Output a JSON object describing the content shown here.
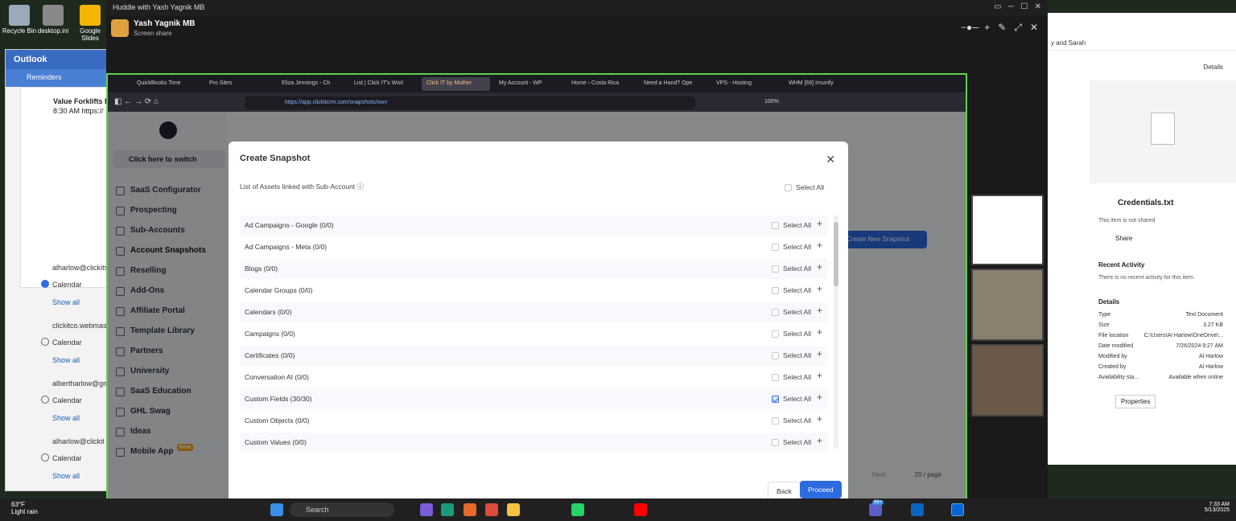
{
  "desktop": {
    "icons": [
      "Recycle Bin",
      "desktop.ini",
      "Google Slides"
    ]
  },
  "outlook": {
    "title": "Outlook",
    "reminders": "Reminders",
    "event_title": "Value Forklifts Bi-",
    "event_time": "8:30 AM  https://",
    "accounts": [
      {
        "name": "alharlow@clickits",
        "cal": "Calendar",
        "show": "Show all",
        "checked": true
      },
      {
        "name": "clickitco.webmast",
        "cal": "Calendar",
        "show": "Show all",
        "checked": false
      },
      {
        "name": "albertharlow@gm",
        "cal": "Calendar",
        "show": "Show all",
        "checked": false
      },
      {
        "name": "alharlow@clickit",
        "cal": "Calendar",
        "show": "Show all",
        "checked": false
      }
    ]
  },
  "huddle": {
    "title": "Huddle with Yash Yagnik MB",
    "user": "Yash Yagnik MB",
    "status": "Screen share"
  },
  "browser": {
    "tabs": [
      "QuickBooks Time",
      "Pro Sites",
      "Eliza Jennings - Ch",
      "List | Click IT's Worl",
      "Click IT by Mother",
      "My Account - WP",
      "Home › Costa Rica",
      "Need a Hand? Ope",
      "VPS - Hosting",
      "WHM [69] Imunify"
    ],
    "url": "https://app.clickitcrm.com/snapshots/own",
    "zoom": "100%"
  },
  "app": {
    "switch": "Click here to switch",
    "nav": [
      "SaaS Configurator",
      "Prospecting",
      "Sub-Accounts",
      "Account Snapshots",
      "Reselling",
      "Add-Ons",
      "Affiliate Portal",
      "Template Library",
      "Partners",
      "University",
      "SaaS Education",
      "GHL Swag",
      "Ideas",
      "Mobile App"
    ],
    "new_badge": "New",
    "create_btn": "Create New Snapshot",
    "pagination": {
      "next": "Next",
      "per_page": "20 / page"
    }
  },
  "modal": {
    "title": "Create Snapshot",
    "subtitle": "List of Assets linked with Sub-Account",
    "select_all": "Select All",
    "rows": [
      {
        "label": "Ad Campaigns - Google (0/0)",
        "checked": false
      },
      {
        "label": "Ad Campaigns - Meta (0/0)",
        "checked": false
      },
      {
        "label": "Blogs (0/0)",
        "checked": false
      },
      {
        "label": "Calendar Groups (0/0)",
        "checked": false
      },
      {
        "label": "Calendars (0/0)",
        "checked": false
      },
      {
        "label": "Campaigns (0/0)",
        "checked": false
      },
      {
        "label": "Certificates (0/0)",
        "checked": false
      },
      {
        "label": "Conversation AI (0/0)",
        "checked": false
      },
      {
        "label": "Custom Fields (30/30)",
        "checked": true
      },
      {
        "label": "Custom Objects (0/0)",
        "checked": false
      },
      {
        "label": "Custom Values (0/0)",
        "checked": false
      }
    ],
    "back": "Back",
    "proceed": "Proceed"
  },
  "files": {
    "header": "y and Sarah",
    "details": "Details",
    "filename": "Credentials.txt",
    "not_shared": "This item is not shared",
    "share": "Share",
    "recent": "Recent Activity",
    "no_recent": "There is no recent activity for this item.",
    "details_title": "Details",
    "props": [
      [
        "Type",
        "Text Document"
      ],
      [
        "Size",
        "3.27 KB"
      ],
      [
        "File location",
        "C:\\Users\\Al Harlow\\OneDrive\\..."
      ],
      [
        "Date modified",
        "7/26/2024 9:27 AM"
      ],
      [
        "Modified by",
        "Al Harlow"
      ],
      [
        "Created by",
        "Al Harlow"
      ],
      [
        "Availability sta...",
        "Available when online"
      ]
    ],
    "properties": "Properties"
  },
  "taskbar": {
    "temp": "63°F",
    "weather": "Light rain",
    "search": "Search",
    "badge_count": "99+",
    "time": "7:33 AM",
    "date": "5/13/2025"
  },
  "colors": {
    "accent": "#2c6be0",
    "green_border": "#5ad54a"
  }
}
